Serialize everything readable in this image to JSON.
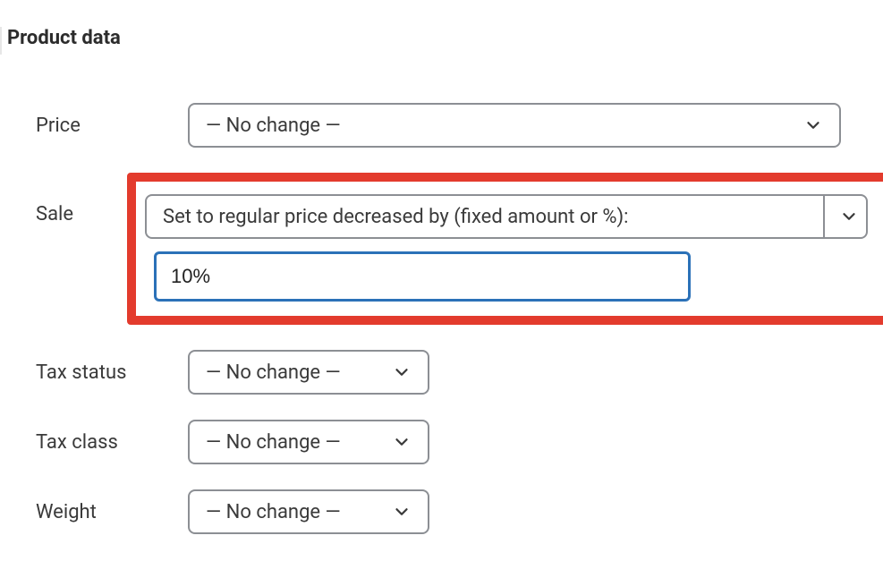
{
  "section_title": "Product data",
  "no_change_label": "— No change —",
  "labels": {
    "price": "Price",
    "sale": "Sale",
    "tax_status": "Tax status",
    "tax_class": "Tax class",
    "weight": "Weight"
  },
  "price": {
    "value": "— No change —"
  },
  "sale": {
    "select_value": "Set to regular price decreased by (fixed amount or %):",
    "input_value": "10%"
  },
  "tax_status": {
    "value": "— No change —"
  },
  "tax_class": {
    "value": "— No change —"
  },
  "weight": {
    "value": "— No change —"
  }
}
